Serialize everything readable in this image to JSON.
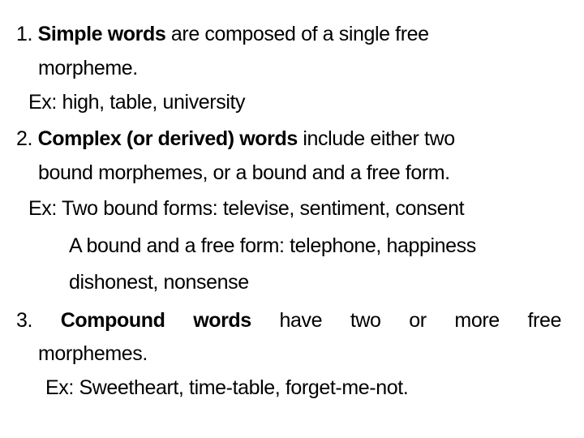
{
  "items": [
    {
      "number": "1.",
      "term": "Simple words",
      "definition": " are composed of a single free",
      "definition_cont": "morpheme.",
      "example": "Ex: high, table, university"
    },
    {
      "number": "2.",
      "term": "Complex (or derived) words",
      "definition": " include either two",
      "definition_cont": "bound morphemes, or a bound and a free form.",
      "example": "Ex: Two bound forms: televise, sentiment, consent",
      "example2": "A bound and a free form: telephone, happiness",
      "example2_cont": "dishonest, nonsense"
    },
    {
      "number": "3.",
      "term_words": [
        "Compound",
        "words"
      ],
      "definition_words": [
        "have",
        "two",
        "or",
        "more",
        "free"
      ],
      "definition_cont": "morphemes.",
      "example": "Ex: Sweetheart, time-table, forget-me-not."
    }
  ]
}
